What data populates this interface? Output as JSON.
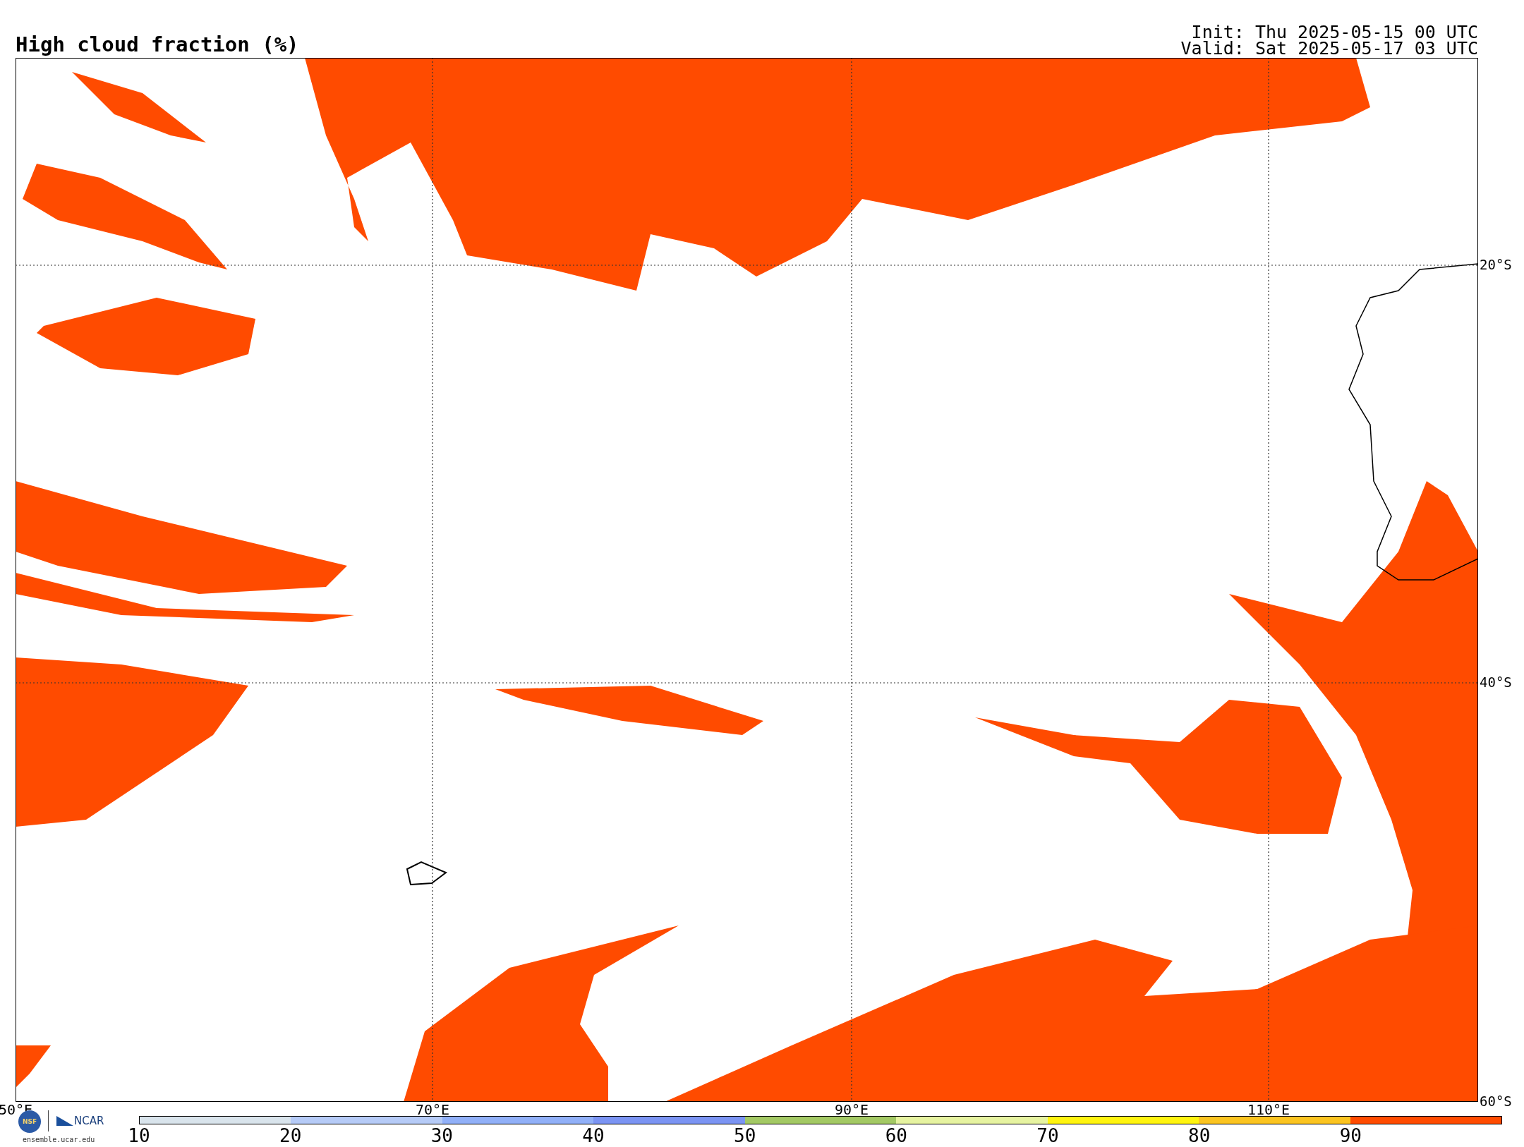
{
  "title": "High cloud fraction (%)",
  "init": "Init: Thu 2025-05-15 00 UTC",
  "valid": "Valid: Sat 2025-05-17 03 UTC",
  "map": {
    "lat_labels": [
      "20°S",
      "40°S",
      "60°S"
    ],
    "lon_labels": [
      "50°E",
      "70°E",
      "90°E",
      "110°E"
    ]
  },
  "logos": {
    "nsf": "NSF",
    "ncar": "NCAR",
    "url": "ensemble.ucar.edu"
  },
  "colorbar": [
    {
      "label": "10",
      "color": "#d9e4ec"
    },
    {
      "label": "20",
      "color": "#b6cbf7"
    },
    {
      "label": "30",
      "color": "#91b0f8"
    },
    {
      "label": "40",
      "color": "#7b94f3"
    },
    {
      "label": "50",
      "color": "#a3c964"
    },
    {
      "label": "60",
      "color": "#e6f3a0"
    },
    {
      "label": "70",
      "color": "#fff40f"
    },
    {
      "label": "80",
      "color": "#fbc420"
    },
    {
      "label": "90",
      "color": "#ff4b00"
    }
  ]
}
